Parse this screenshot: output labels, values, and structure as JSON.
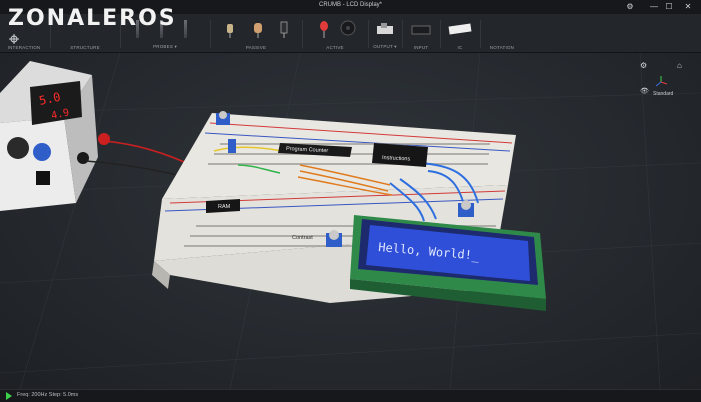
{
  "window": {
    "title": "CRUMB - LCD Display*"
  },
  "logo": {
    "text": "ZONALEROS"
  },
  "toolbar": {
    "groups": [
      {
        "label": "INTERACTION"
      },
      {
        "label": "STRUCTURE"
      },
      {
        "label": "PROBES ▾"
      },
      {
        "label": "PASSIVE"
      },
      {
        "label": "ACTIVE"
      },
      {
        "label": "OUTPUT ▾"
      },
      {
        "label": "INPUT"
      },
      {
        "label": "IC"
      },
      {
        "label": "NOTATION"
      }
    ]
  },
  "viewport": {
    "view_label": "Standard",
    "psu": {
      "display_top": "5.0",
      "display_bottom": "4.9"
    },
    "chips": [
      "Program Counter",
      "Instructions",
      "RAM"
    ],
    "pot_label": "Contrast",
    "lcd_text": "Hello, World!_"
  },
  "status": {
    "text": "Freq: 200Hz  Step: 5.0ms"
  },
  "colors": {
    "accent": "#3ecf4a",
    "lcd_bg": "#2f4fd8",
    "lcd_text": "#dfe6ff",
    "breadboard": "#e9e7e1",
    "toolbar": "#23262b"
  }
}
